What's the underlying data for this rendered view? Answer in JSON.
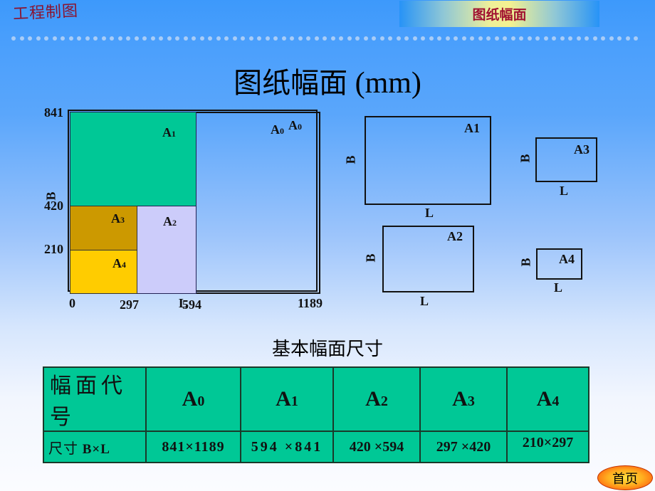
{
  "header": {
    "course_title": "工程制图",
    "section_banner": "图纸幅面"
  },
  "main_title": {
    "cn": "图纸幅面",
    "unit": " (mm)"
  },
  "nested_diagram": {
    "y_ticks": [
      "841",
      "420",
      "210"
    ],
    "x_ticks": [
      "0",
      "297",
      "594",
      "1189"
    ],
    "y_axis_label": "B",
    "x_axis_label": "L",
    "regions": [
      {
        "name": "A0",
        "sub": "0",
        "base": "A",
        "fill": "none"
      },
      {
        "name": "A1",
        "base": "A",
        "sub": "1",
        "fill": "#00c896"
      },
      {
        "name": "A2",
        "base": "A",
        "sub": "2",
        "fill": "#ccccfa"
      },
      {
        "name": "A3",
        "base": "A",
        "sub": "3",
        "fill": "#cc9900"
      },
      {
        "name": "A4",
        "base": "A",
        "sub": "4",
        "fill": "#ffcc00"
      }
    ],
    "a0_label_1": "A0",
    "a0_label_2": "A0"
  },
  "format_examples": [
    {
      "code": "A1",
      "b_label": "B",
      "l_label": "L"
    },
    {
      "code": "A2",
      "b_label": "B",
      "l_label": "L"
    },
    {
      "code": "A3",
      "b_label": "B",
      "l_label": "L"
    },
    {
      "code": "A4",
      "b_label": "B",
      "l_label": "L"
    }
  ],
  "table": {
    "caption": "基本幅面尺寸",
    "row1_header": "幅面代号",
    "row2_header_cn": "尺寸",
    "row2_header_en": " B×L",
    "codes": [
      {
        "base": "A",
        "sub": "0"
      },
      {
        "base": "A",
        "sub": "1"
      },
      {
        "base": "A",
        "sub": "2"
      },
      {
        "base": "A",
        "sub": "3"
      },
      {
        "base": "A",
        "sub": "4"
      }
    ],
    "sizes": [
      "841×1189",
      "594 ×841",
      "420 ×594",
      "297 ×420",
      "210×297"
    ]
  },
  "home_button": "首页",
  "colors": {
    "table_bg": "#00c896",
    "title_red": "#8a1430"
  }
}
